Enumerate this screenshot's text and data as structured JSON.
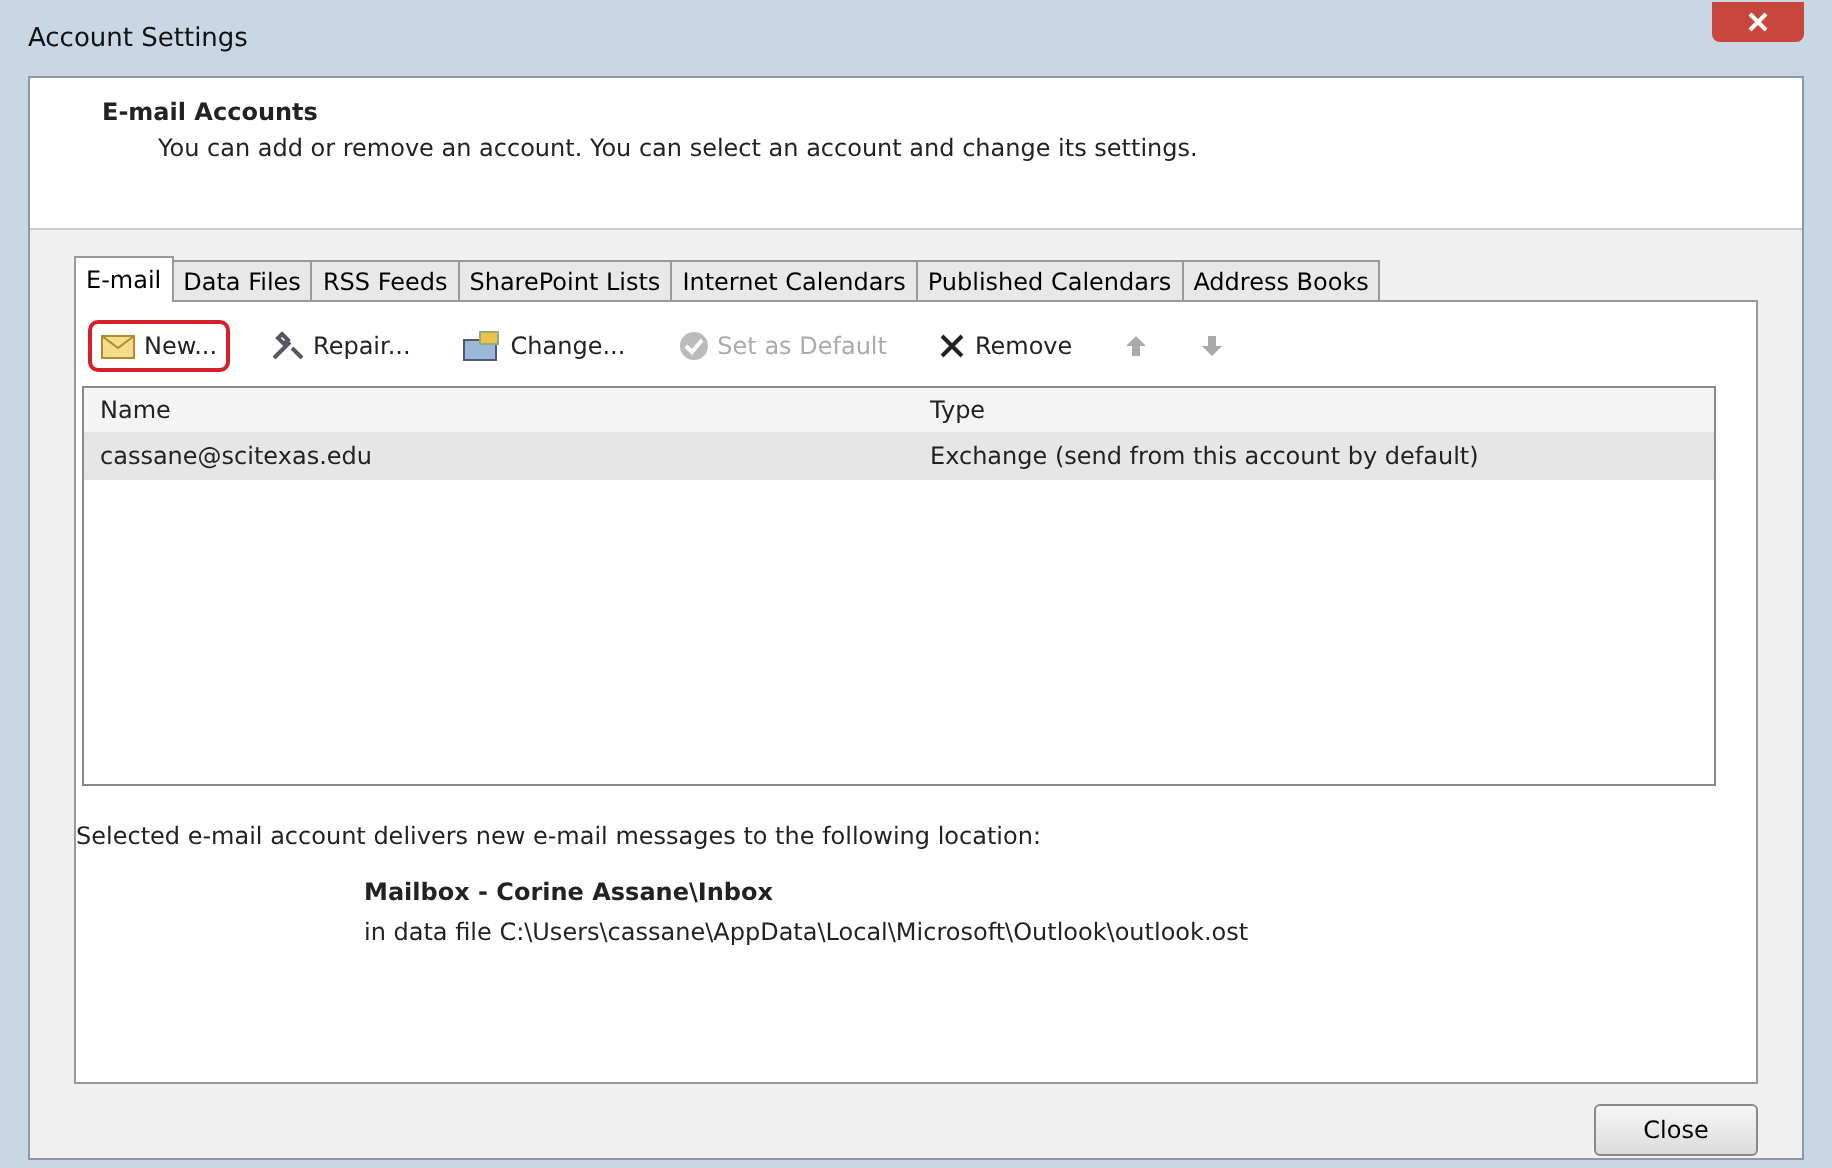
{
  "window": {
    "title": "Account Settings"
  },
  "header": {
    "title": "E-mail Accounts",
    "subtitle": "You can add or remove an account. You can select an account and change its settings."
  },
  "tabs": [
    {
      "label": "E-mail",
      "selected": true
    },
    {
      "label": "Data Files",
      "selected": false
    },
    {
      "label": "RSS Feeds",
      "selected": false
    },
    {
      "label": "SharePoint Lists",
      "selected": false
    },
    {
      "label": "Internet Calendars",
      "selected": false
    },
    {
      "label": "Published Calendars",
      "selected": false
    },
    {
      "label": "Address Books",
      "selected": false
    }
  ],
  "toolbar": [
    {
      "kind": "new",
      "label": "New...",
      "disabled": false,
      "highlighted": true
    },
    {
      "kind": "repair",
      "label": "Repair...",
      "disabled": false,
      "highlighted": false
    },
    {
      "kind": "change",
      "label": "Change...",
      "disabled": false,
      "highlighted": false
    },
    {
      "kind": "default",
      "label": "Set as Default",
      "disabled": true,
      "highlighted": false
    },
    {
      "kind": "remove",
      "label": "Remove",
      "disabled": false,
      "highlighted": false
    },
    {
      "kind": "up",
      "disabled": true,
      "highlighted": false
    },
    {
      "kind": "down",
      "disabled": true,
      "highlighted": false
    }
  ],
  "table": {
    "columns": [
      "Name",
      "Type"
    ],
    "rows": [
      {
        "cells": [
          "cassane@scitexas.edu",
          "Exchange (send from this account by default)"
        ],
        "selected": true
      }
    ]
  },
  "delivery": {
    "text": "Selected e-mail account delivers new e-mail messages to the following location:",
    "mailbox": "Mailbox - Corine Assane\\Inbox",
    "path": "in data file C:\\Users\\cassane\\AppData\\Local\\Microsoft\\Outlook\\outlook.ost"
  },
  "buttons": [
    "Close"
  ]
}
